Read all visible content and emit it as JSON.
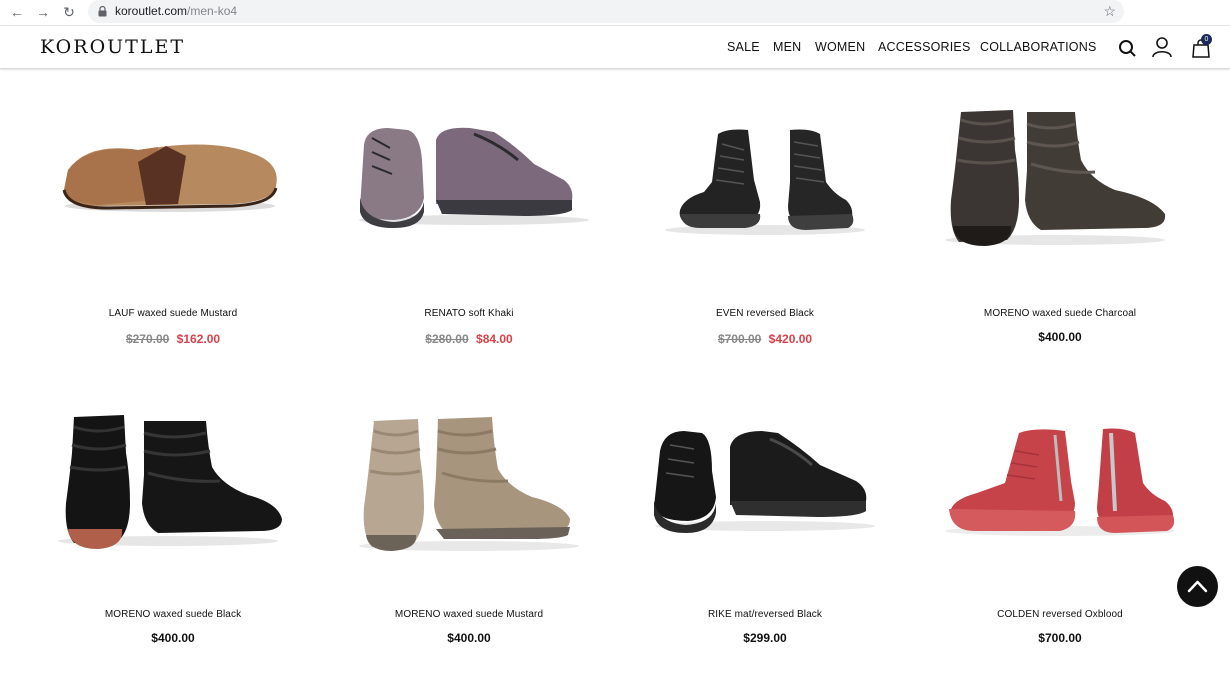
{
  "browser": {
    "url_domain": "koroutlet.com",
    "url_path": "/men-ko4"
  },
  "header": {
    "logo": "KOROUTLET",
    "nav": [
      "SALE",
      "MEN",
      "WOMEN",
      "ACCESSORIES",
      "COLLABORATIONS"
    ],
    "cart_count": "0"
  },
  "products": [
    {
      "name": "LAUF waxed suede Mustard",
      "old_price": "$270.00",
      "price": "$162.00",
      "on_sale": true
    },
    {
      "name": "RENATO soft Khaki",
      "old_price": "$280.00",
      "price": "$84.00",
      "on_sale": true
    },
    {
      "name": "EVEN reversed Black",
      "old_price": "$700.00",
      "price": "$420.00",
      "on_sale": true
    },
    {
      "name": "MORENO waxed suede Charcoal",
      "old_price": "",
      "price": "$400.00",
      "on_sale": false
    },
    {
      "name": "MORENO waxed suede Black",
      "old_price": "",
      "price": "$400.00",
      "on_sale": false
    },
    {
      "name": "MORENO waxed suede Mustard",
      "old_price": "",
      "price": "$400.00",
      "on_sale": false
    },
    {
      "name": "RIKE mat/reversed Black",
      "old_price": "",
      "price": "$299.00",
      "on_sale": false
    },
    {
      "name": "COLDEN reversed Oxblood",
      "old_price": "",
      "price": "$700.00",
      "on_sale": false
    }
  ],
  "colors": {
    "sale_price": "#d9414a",
    "old_price": "#888888",
    "cart_badge": "#1a2a5a"
  }
}
